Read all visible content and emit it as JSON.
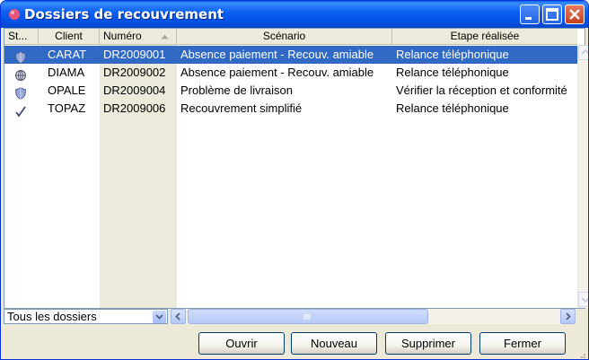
{
  "window": {
    "title": "Dossiers de recouvrement"
  },
  "grid": {
    "columns": [
      {
        "key": "status",
        "label": "St..."
      },
      {
        "key": "client",
        "label": "Client"
      },
      {
        "key": "numero",
        "label": "Numéro"
      },
      {
        "key": "scenario",
        "label": "Scénario"
      },
      {
        "key": "etape",
        "label": "Etape réalisée"
      }
    ],
    "rows": [
      {
        "status_icon": "shield-icon",
        "client": "CARAT",
        "numero": "DR2009001",
        "scenario": "Absence paiement - Recouv. amiable",
        "etape": "Relance téléphonique",
        "selected": true
      },
      {
        "status_icon": "globe-icon",
        "client": "DIAMA",
        "numero": "DR2009002",
        "scenario": "Absence paiement - Recouv. amiable",
        "etape": "Relance téléphonique",
        "selected": false
      },
      {
        "status_icon": "shield-icon",
        "client": "OPALE",
        "numero": "DR2009004",
        "scenario": "Problème de livraison",
        "etape": "Vérifier la réception et conformité",
        "selected": false
      },
      {
        "status_icon": "checkmark-icon",
        "client": "TOPAZ",
        "numero": "DR2009006",
        "scenario": "Recouvrement simplifié",
        "etape": "Relance téléphonique",
        "selected": false
      }
    ],
    "sort_column": "numero",
    "sort_direction": "ascending"
  },
  "filter": {
    "selected": "Tous les dossiers"
  },
  "buttons": {
    "open": "Ouvrir",
    "new": "Nouveau",
    "delete": "Supprimer",
    "close": "Fermer"
  },
  "colors": {
    "titlebar": "#0b61f2",
    "selection": "#316ac5",
    "window_bg": "#ece9d8",
    "numero_column_bg": "#ebeadb"
  }
}
